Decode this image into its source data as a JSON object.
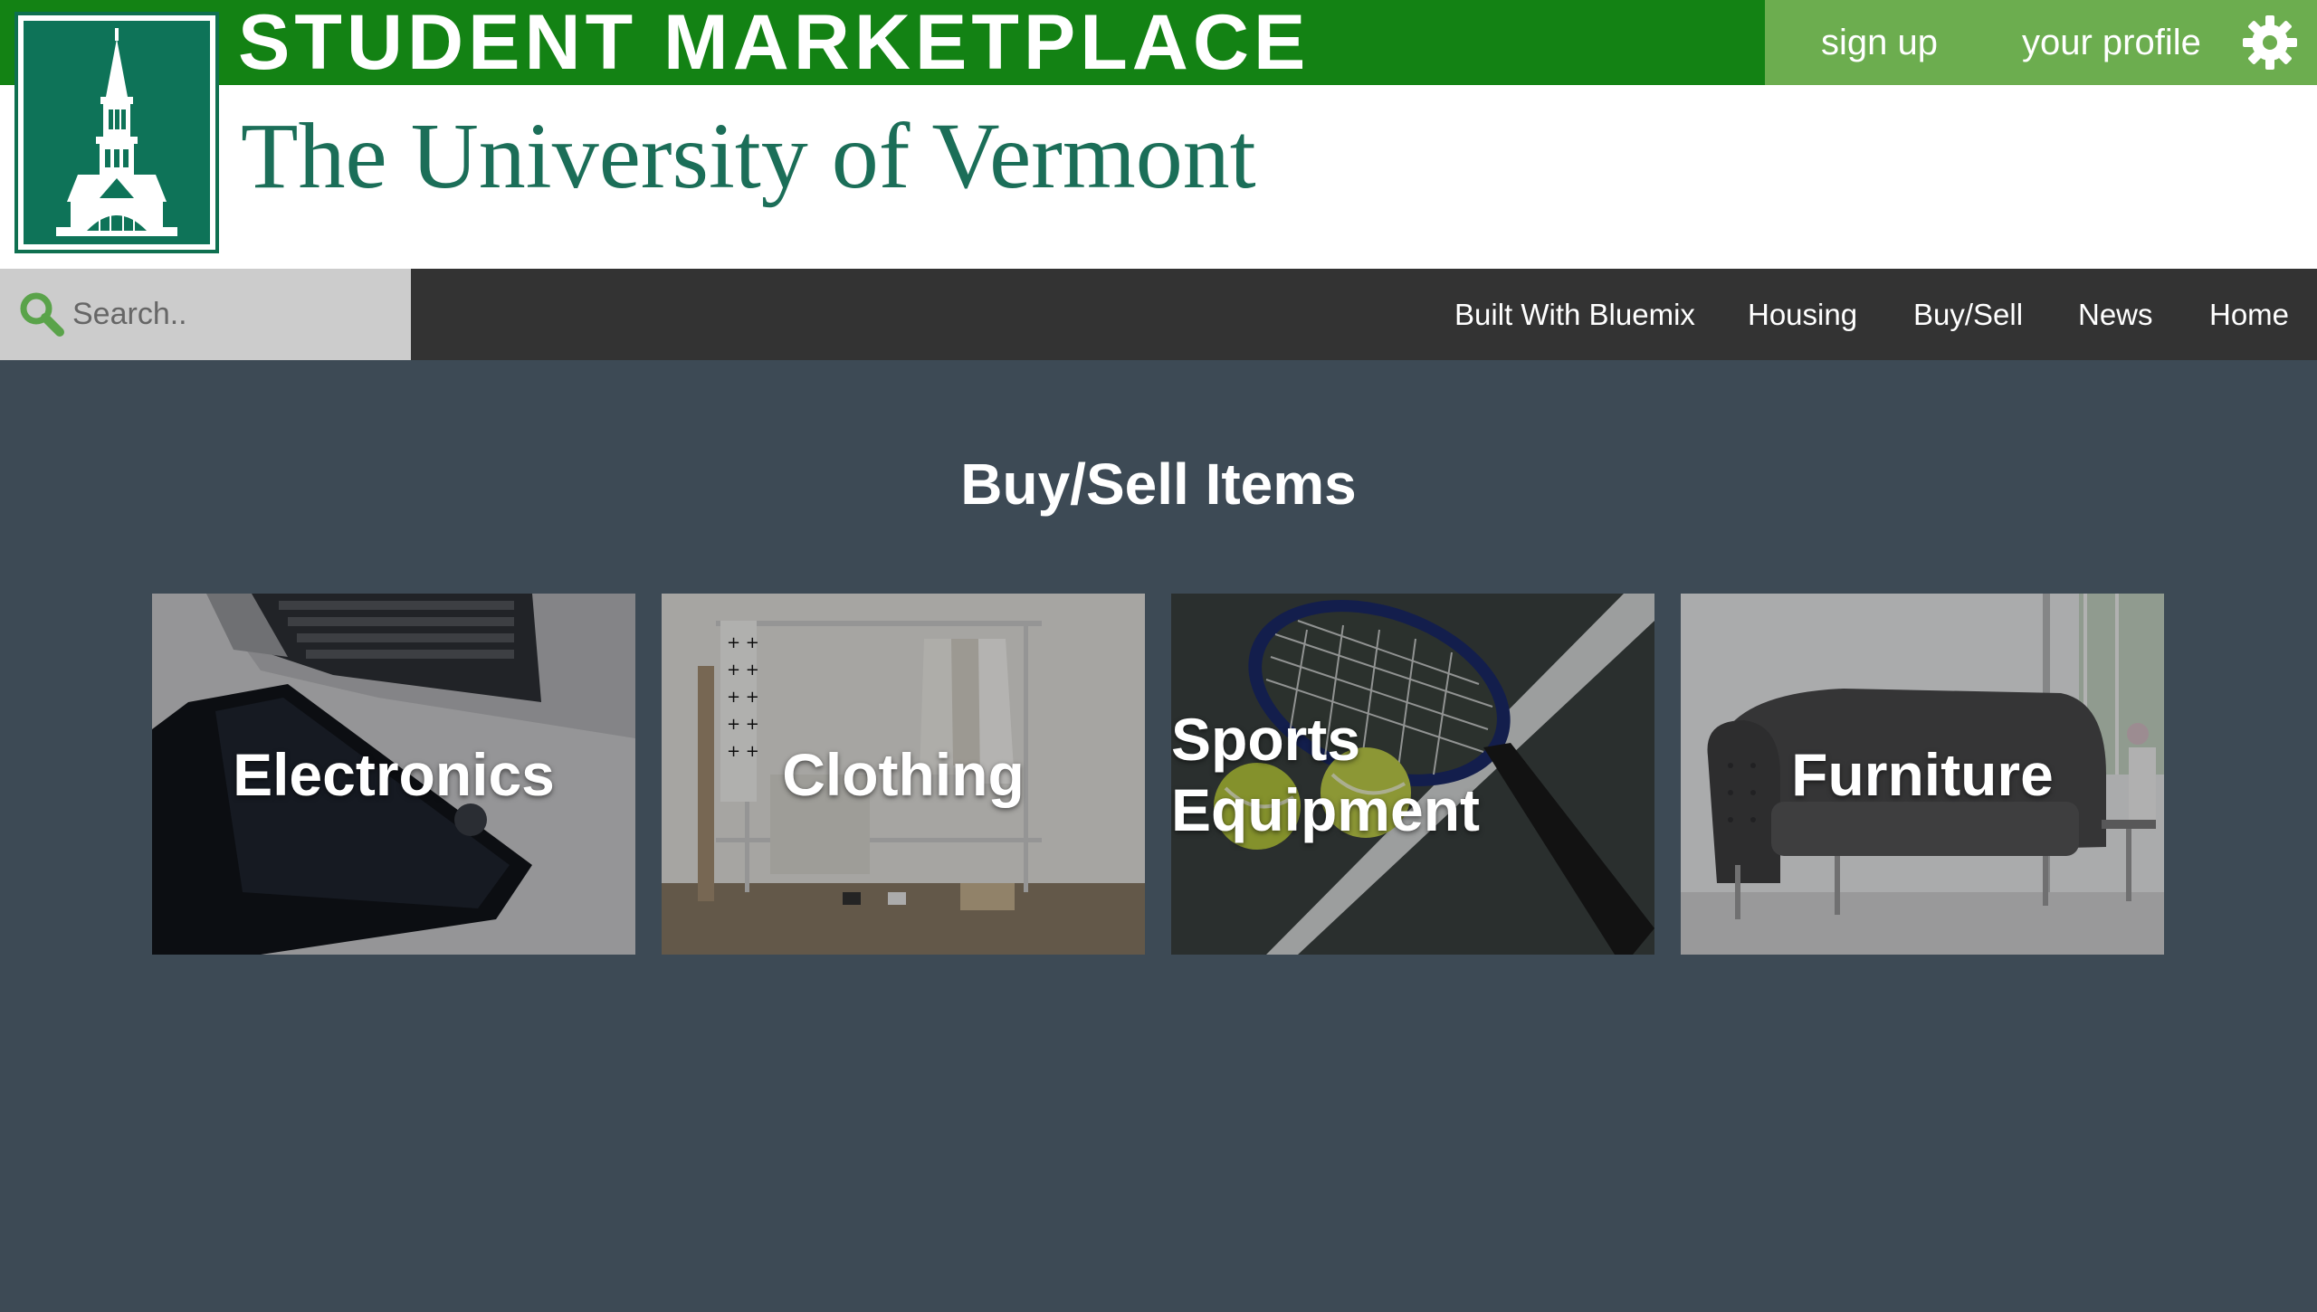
{
  "header": {
    "site_title": "STUDENT MARKETPLACE",
    "university_name": "The University of Vermont",
    "user_menu": {
      "signup_label": "sign up",
      "profile_label": "your profile",
      "settings_icon": "gear-icon"
    },
    "logo_icon": "bell-tower-icon"
  },
  "nav": {
    "search": {
      "placeholder": "Search..",
      "value": "",
      "icon": "search-icon"
    },
    "links": [
      {
        "label": "Built With Bluemix"
      },
      {
        "label": "Housing"
      },
      {
        "label": "Buy/Sell"
      },
      {
        "label": "News"
      },
      {
        "label": "Home"
      }
    ]
  },
  "main": {
    "title": "Buy/Sell Items",
    "categories": [
      {
        "label": "Electronics",
        "image": "laptop-and-phone-photo"
      },
      {
        "label": "Clothing",
        "image": "clothing-rack-photo"
      },
      {
        "label": "Sports Equipment",
        "image": "tennis-racket-photo"
      },
      {
        "label": "Furniture",
        "image": "sofa-photo"
      }
    ]
  },
  "colors": {
    "title_bar": "#138214",
    "user_bar": "#6cad4f",
    "uvm_green": "#0e7358",
    "nav_bg": "#333333",
    "search_bg": "#cccccc",
    "page_bg": "#3d4a55"
  }
}
